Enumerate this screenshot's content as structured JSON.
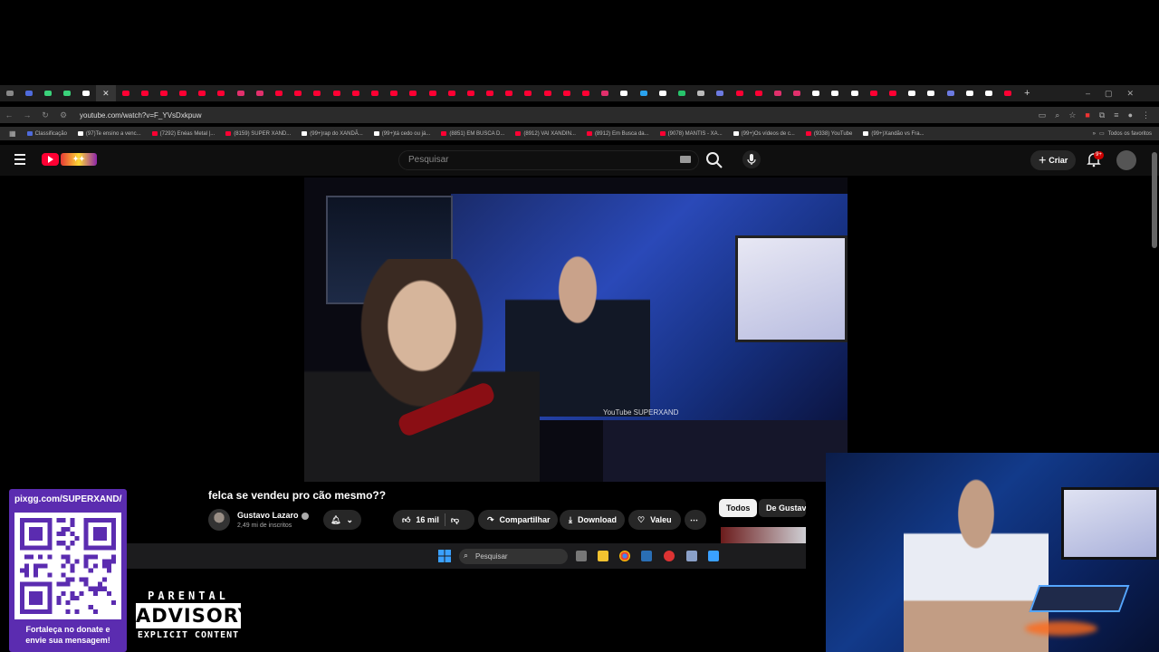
{
  "browser": {
    "url": "youtube.com/watch?v=F_YVsDxkpuw",
    "bookmarks": [
      {
        "label": "Classificação",
        "color": "#4f6bdc"
      },
      {
        "label": "(97)Te ensino a venc...",
        "color": "#ffffff"
      },
      {
        "label": "(7292) Enéas Metal |...",
        "color": "#ff0033"
      },
      {
        "label": "(8159) SUPER XAND...",
        "color": "#ff0033"
      },
      {
        "label": "(99+)rap do XANDÃ...",
        "color": "#ffffff"
      },
      {
        "label": "(99+)tá cedo ou já...",
        "color": "#ffffff"
      },
      {
        "label": "(8851) EM BUSCA D...",
        "color": "#ff0033"
      },
      {
        "label": "(8912) VAI XANDIN...",
        "color": "#ff0033"
      },
      {
        "label": "(8912) Em Busca da...",
        "color": "#ff0033"
      },
      {
        "label": "(9078) MANTIS - XA...",
        "color": "#ff0033"
      },
      {
        "label": "(99+)Os vídeos de c...",
        "color": "#ffffff"
      },
      {
        "label": "(9338) YouTube",
        "color": "#ff0033"
      },
      {
        "label": "(99+)Xandão vs Fra...",
        "color": "#ffffff"
      }
    ],
    "all_favorites": "Todos os favoritos"
  },
  "youtube": {
    "search_placeholder": "Pesquisar",
    "create_label": "Criar",
    "notifications_badge": "9+",
    "video": {
      "title": "felca se vendeu pro cão mesmo??",
      "channel_name": "Gustavo Lazaro",
      "subscribers": "2,49 mi de inscritos",
      "likes": "16 mil",
      "share_label": "Compartilhar",
      "download_label": "Download",
      "thanks_label": "Valeu",
      "player_watermark": "YouTube SUPERXAND"
    },
    "chips": [
      "Todos",
      "De Gustavo"
    ]
  },
  "taskbar": {
    "search_placeholder": "Pesquisar"
  },
  "overlay": {
    "pix_url": "pixgg.com/SUPERXAND/",
    "donate_line1": "Fortaleça no donate e",
    "donate_line2": "envie sua mensagem!",
    "advisory_top": "PARENTAL",
    "advisory_mid": "ADVISORY",
    "advisory_bot": "EXPLICIT CONTENT"
  },
  "colors": {
    "youtube_red": "#ff0033",
    "overlay_purple": "#5b2cb0",
    "chrome_dark": "#2b2b2b"
  }
}
